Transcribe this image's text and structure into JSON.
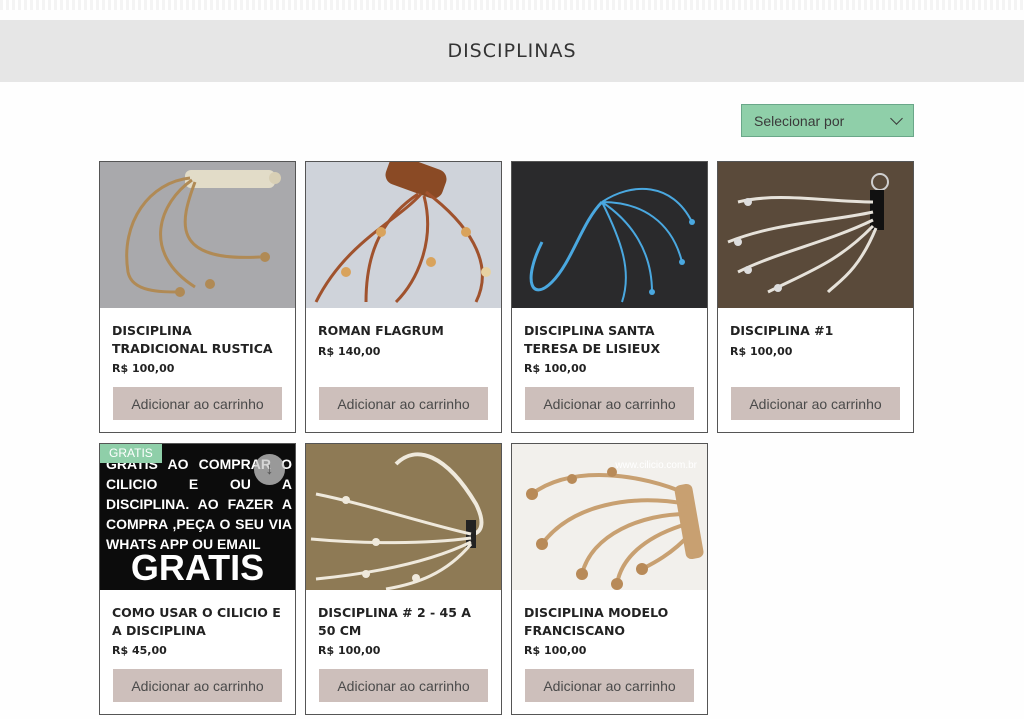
{
  "page": {
    "title": "DISCIPLINAS"
  },
  "sort": {
    "label": "Selecionar por"
  },
  "products": [
    {
      "name": "DISCIPLINA TRADICIONAL RUSTICA",
      "price": "R$ 100,00",
      "button": "Adicionar ao carrinho"
    },
    {
      "name": "ROMAN FLAGRUM",
      "price": "R$ 140,00",
      "button": "Adicionar ao carrinho"
    },
    {
      "name": "DISCIPLINA SANTA TERESA DE LISIEUX",
      "price": "R$ 100,00",
      "button": "Adicionar ao carrinho"
    },
    {
      "name": "DISCIPLINA #1",
      "price": "R$ 100,00",
      "button": "Adicionar ao carrinho"
    },
    {
      "name": "COMO USAR O CILICIO E A DISCIPLINA",
      "price": "R$ 45,00",
      "button": "Adicionar ao carrinho",
      "badge": "GRATIS",
      "image_text": "GRATIS AO COMPRAR O CILICIO E OU A DISCIPLINA. AO FAZER A COMPRA ,PEÇA O SEU VIA WHATS APP OU EMAIL",
      "image_big_text": "GRATIS"
    },
    {
      "name": "DISCIPLINA # 2 - 45 a 50 CM",
      "price": "R$ 100,00",
      "button": "Adicionar ao carrinho"
    },
    {
      "name": "DISCIPLINA MODELO FRANCISCANO",
      "price": "R$ 100,00",
      "button": "Adicionar ao carrinho",
      "watermark": "www.cilicio.com.br"
    }
  ],
  "colors": {
    "accent": "#8fcfa9",
    "button": "#cdbfbb",
    "banner": "#e6e6e6"
  },
  "icons": {
    "sort": "chevron-down-icon",
    "download": "download-icon"
  }
}
